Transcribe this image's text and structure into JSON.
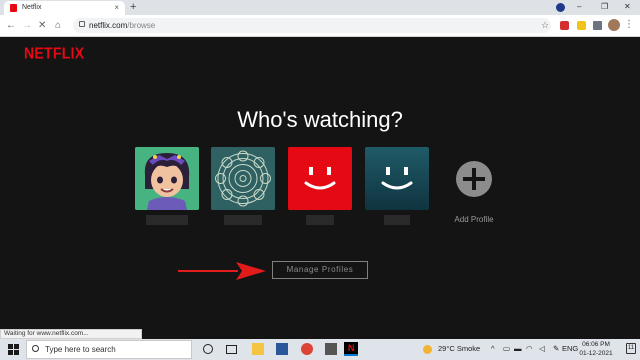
{
  "browser": {
    "tab_title": "Netflix",
    "new_tab_icon": "+",
    "url_host": "netflix.com",
    "url_path": "/browse",
    "status_text": "Waiting for www.netflix.com..."
  },
  "netflix": {
    "logo": "NETFLIX",
    "heading": "Who's watching?",
    "add_profile_label": "Add Profile",
    "manage_profiles_label": "Manage Profiles",
    "profiles": [
      {
        "avatar": "anime-girl-avatar",
        "bg": "#3fa37a"
      },
      {
        "avatar": "mandala-avatar",
        "bg": "#2f5f63"
      },
      {
        "avatar": "red-smiley-avatar",
        "bg": "#e50914"
      },
      {
        "avatar": "teal-smiley-avatar",
        "bg": "#1a4a55"
      }
    ],
    "accent_color": "#e50914"
  },
  "taskbar": {
    "search_placeholder": "Type here to search",
    "weather": "29°C  Smoke",
    "language": "ENG",
    "time": "06:06 PM",
    "date": "01-12-2021",
    "notification_count": "11"
  }
}
